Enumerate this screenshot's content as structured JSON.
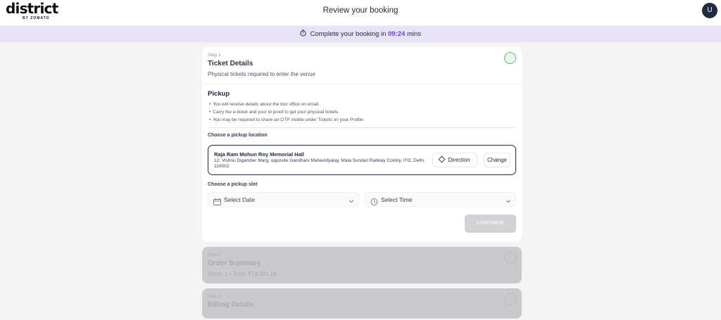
{
  "header": {
    "logo_text": "district",
    "logo_sub": "BY ZOMATO",
    "title": "Review your booking",
    "avatar_initial": "U"
  },
  "banner": {
    "prefix": "Complete your booking in",
    "timer": "09:24",
    "suffix": "mins",
    "icon": "stopwatch-icon"
  },
  "step1": {
    "step_label": "Step 1",
    "title": "Ticket Details",
    "subtitle": "Physical tickets required to enter the venue",
    "status": "active",
    "pickup": {
      "title": "Pickup",
      "bullets": [
        "You will receive details about the box office on email.",
        "Carry the e-ticket and your id proof to get your physical tickets.",
        "You may be required to share an OTP visible under Tickets on your Profile."
      ],
      "location_label": "Choose a pickup location",
      "location": {
        "name": "Raja Ram Mohun Roy Memorial Hall",
        "address": "12, Vishnu Digamber Marg, opposite Gandharv Mahavidyalay, Mata Sundari Railway Colony, ITO, Delhi, 110002",
        "direction_label": "Direction",
        "change_label": "Change"
      },
      "slot_label": "Choose a pickup slot",
      "date_placeholder": "Select Date",
      "time_placeholder": "Select Time",
      "continue_label": "CONTINUE"
    }
  },
  "step2": {
    "step_label": "Step 2",
    "title": "Order Summary",
    "subtitle": "Items: 1 • Total: ₹19,381.18"
  },
  "step3": {
    "step_label": "Step 3",
    "title": "Billing Details"
  },
  "colors": {
    "accent": "#6d3fd6",
    "banner_bg": "#e9e3f7",
    "avatar_bg": "#1f2a44",
    "disabled_card": "#c9c9ce"
  }
}
